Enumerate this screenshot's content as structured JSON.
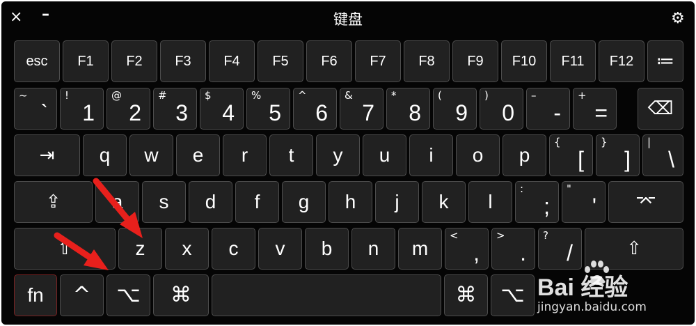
{
  "window": {
    "title": "键盘",
    "close_icon": "×",
    "minimize_icon": "–",
    "settings_icon": "⚙"
  },
  "rows": {
    "function": [
      {
        "name": "esc",
        "label": "esc"
      },
      {
        "name": "f1",
        "label": "F1"
      },
      {
        "name": "f2",
        "label": "F2"
      },
      {
        "name": "f3",
        "label": "F3"
      },
      {
        "name": "f4",
        "label": "F4"
      },
      {
        "name": "f5",
        "label": "F5"
      },
      {
        "name": "f6",
        "label": "F6"
      },
      {
        "name": "f7",
        "label": "F7"
      },
      {
        "name": "f8",
        "label": "F8"
      },
      {
        "name": "f9",
        "label": "F9"
      },
      {
        "name": "f10",
        "label": "F10"
      },
      {
        "name": "f11",
        "label": "F11"
      },
      {
        "name": "f12",
        "label": "F12"
      },
      {
        "name": "menu",
        "label": "≔",
        "icon": "list-icon"
      }
    ],
    "number": [
      {
        "name": "backtick",
        "shift": "~",
        "main": "`"
      },
      {
        "name": "1",
        "shift": "!",
        "main": "1"
      },
      {
        "name": "2",
        "shift": "@",
        "main": "2"
      },
      {
        "name": "3",
        "shift": "#",
        "main": "3"
      },
      {
        "name": "4",
        "shift": "$",
        "main": "4"
      },
      {
        "name": "5",
        "shift": "%",
        "main": "5"
      },
      {
        "name": "6",
        "shift": "^",
        "main": "6"
      },
      {
        "name": "7",
        "shift": "&",
        "main": "7"
      },
      {
        "name": "8",
        "shift": "*",
        "main": "8"
      },
      {
        "name": "9",
        "shift": "(",
        "main": "9"
      },
      {
        "name": "0",
        "shift": ")",
        "main": "0"
      },
      {
        "name": "minus",
        "shift": "–",
        "main": "-"
      },
      {
        "name": "equals",
        "shift": "+",
        "main": "="
      },
      {
        "name": "delete",
        "label": "⌫",
        "icon": "delete-icon"
      }
    ],
    "qwerty": [
      {
        "name": "tab",
        "label": "⇥",
        "icon": "tab-icon"
      },
      {
        "name": "q",
        "label": "q"
      },
      {
        "name": "w",
        "label": "w"
      },
      {
        "name": "e",
        "label": "e"
      },
      {
        "name": "r",
        "label": "r"
      },
      {
        "name": "t",
        "label": "t"
      },
      {
        "name": "y",
        "label": "y"
      },
      {
        "name": "u",
        "label": "u"
      },
      {
        "name": "i",
        "label": "i"
      },
      {
        "name": "o",
        "label": "o"
      },
      {
        "name": "p",
        "label": "p"
      },
      {
        "name": "lbracket",
        "shift": "{",
        "main": "["
      },
      {
        "name": "rbracket",
        "shift": "}",
        "main": "]"
      },
      {
        "name": "backslash",
        "shift": "|",
        "main": "\\"
      }
    ],
    "home": [
      {
        "name": "caps-lock",
        "label": "⇪",
        "icon": "caps-lock-icon"
      },
      {
        "name": "a",
        "label": "a"
      },
      {
        "name": "s",
        "label": "s"
      },
      {
        "name": "d",
        "label": "d"
      },
      {
        "name": "f",
        "label": "f"
      },
      {
        "name": "g",
        "label": "g"
      },
      {
        "name": "h",
        "label": "h"
      },
      {
        "name": "j",
        "label": "j"
      },
      {
        "name": "k",
        "label": "k"
      },
      {
        "name": "l",
        "label": "l"
      },
      {
        "name": "semicolon",
        "shift": ":",
        "main": ";"
      },
      {
        "name": "quote",
        "shift": "\"",
        "main": "'"
      },
      {
        "name": "return",
        "label": "⌤",
        "icon": "return-icon"
      }
    ],
    "bottom": [
      {
        "name": "left-shift",
        "label": "⇧",
        "icon": "shift-icon"
      },
      {
        "name": "z",
        "label": "z"
      },
      {
        "name": "x",
        "label": "x"
      },
      {
        "name": "c",
        "label": "c"
      },
      {
        "name": "v",
        "label": "v"
      },
      {
        "name": "b",
        "label": "b"
      },
      {
        "name": "n",
        "label": "n"
      },
      {
        "name": "m",
        "label": "m"
      },
      {
        "name": "comma",
        "shift": "<",
        "main": ","
      },
      {
        "name": "period",
        "shift": ">",
        "main": "."
      },
      {
        "name": "slash",
        "shift": "?",
        "main": "/"
      },
      {
        "name": "right-shift",
        "label": "⇧",
        "icon": "shift-icon"
      }
    ],
    "modifier": [
      {
        "name": "fn",
        "label": "fn"
      },
      {
        "name": "control",
        "label": "^",
        "icon": "control-icon"
      },
      {
        "name": "option",
        "label": "⌥",
        "icon": "option-icon"
      },
      {
        "name": "command",
        "label": "⌘",
        "icon": "command-icon"
      },
      {
        "name": "space",
        "label": ""
      },
      {
        "name": "right-command",
        "label": "⌘",
        "icon": "command-icon"
      },
      {
        "name": "right-option",
        "label": "⌥",
        "icon": "option-icon"
      }
    ]
  },
  "annotation": {
    "arrow_color": "#e8201c",
    "arrows": [
      "red-arrow-to-z-key",
      "red-arrow-to-option-key"
    ]
  },
  "watermark": {
    "logo": "Bai  经验",
    "url": "jingyan.baidu.com"
  }
}
